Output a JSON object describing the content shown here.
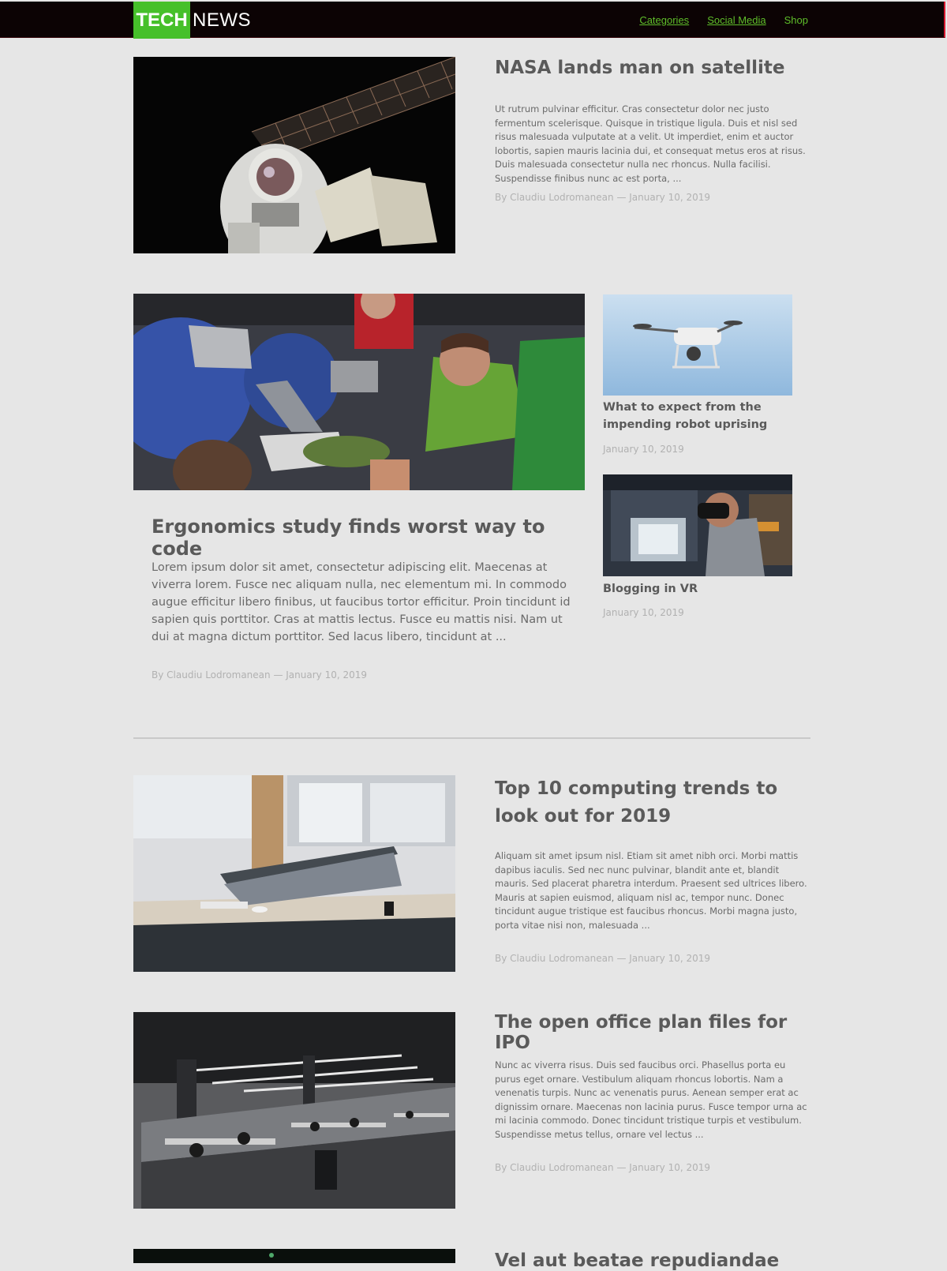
{
  "header": {
    "logo_tech": "TECH",
    "logo_news": "NEWS",
    "nav": [
      "Categories",
      "Social Media",
      "Shop"
    ]
  },
  "featured": {
    "title": "NASA lands man on satellite",
    "excerpt": "Ut rutrum pulvinar efficitur. Cras consectetur dolor nec justo fermentum scelerisque. Quisque in tristique ligula. Duis et nisl sed risus malesuada vulputate at a velit. Ut imperdiet, enim et auctor lobortis, sapien mauris lacinia dui, et consequat metus eros at risus. Duis malesuada consectetur nulla nec rhoncus. Nulla facilisi. Suspendisse finibus nunc ac est porta, ...",
    "meta": "By Claudiu Lodromanean — January 10, 2019"
  },
  "main_story": {
    "title": "Ergonomics study finds worst way to code",
    "excerpt": "Lorem ipsum dolor sit amet, consectetur adipiscing elit. Maecenas at viverra lorem. Fusce nec aliquam nulla, nec elementum mi. In commodo augue efficitur libero finibus, ut faucibus tortor efficitur. Proin tincidunt id sapien quis porttitor. Cras at mattis lectus. Fusce eu mattis nisi. Nam ut dui at magna dictum porttitor. Sed lacus libero, tincidunt at ...",
    "meta": "By Claudiu Lodromanean — January 10, 2019"
  },
  "side_stories": [
    {
      "title": "What to expect from the impending robot uprising",
      "date": "January 10, 2019"
    },
    {
      "title": "Blogging in VR",
      "date": "January 10, 2019"
    }
  ],
  "articles": [
    {
      "title": "Top 10 computing trends to look out for 2019",
      "excerpt": "Aliquam sit amet ipsum nisl. Etiam sit amet nibh orci. Morbi mattis dapibus iaculis. Sed nec nunc pulvinar, blandit ante et, blandit mauris. Sed placerat pharetra interdum. Praesent sed ultrices libero. Mauris at sapien euismod, aliquam nisl ac, tempor nunc. Donec tincidunt augue tristique est faucibus rhoncus. Morbi magna justo, porta vitae nisi non, malesuada ...",
      "meta": "By Claudiu Lodromanean — January 10, 2019"
    },
    {
      "title": "The open office plan files for IPO",
      "excerpt": "Nunc ac viverra risus. Duis sed faucibus orci. Phasellus porta eu purus eget ornare. Vestibulum aliquam rhoncus lobortis. Nam a venenatis turpis. Nunc ac venenatis purus. Aenean semper erat ac dignissim ornare. Maecenas non lacinia purus. Fusce tempor urna ac mi lacinia commodo. Donec tincidunt tristique turpis et vestibulum. Suspendisse metus tellus, ornare vel lectus ...",
      "meta": "By Claudiu Lodromanean — January 10, 2019"
    },
    {
      "title": "Vel aut beatae repudiandae"
    }
  ],
  "colors": {
    "background": "#e6e6e6",
    "header_bg": "#0c0304",
    "brand_green": "#46c02a",
    "nav_link": "#5fbf2a",
    "text": "#5a5a5a",
    "meta": "#b1b1b1"
  }
}
